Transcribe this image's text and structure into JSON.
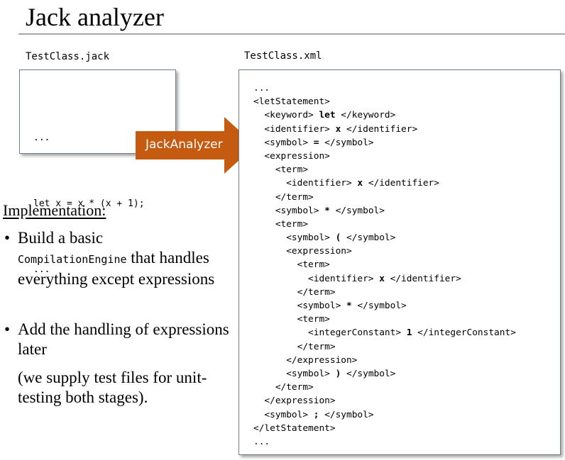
{
  "slide": {
    "title": "Jack analyzer"
  },
  "source": {
    "filename": "TestClass.jack",
    "lines": [
      "...",
      "let x = x * (x + 1);",
      "..."
    ]
  },
  "arrow": {
    "label": "JackAnalyzer",
    "color": "#c55a11"
  },
  "output": {
    "filename": "TestClass.xml",
    "lines": [
      {
        "pre": "...",
        "bold": "",
        "post": ""
      },
      {
        "pre": "<letStatement>",
        "bold": "",
        "post": ""
      },
      {
        "pre": "  <keyword> ",
        "bold": "let",
        "post": " </keyword>"
      },
      {
        "pre": "  <identifier> ",
        "bold": "x",
        "post": " </identifier>"
      },
      {
        "pre": "  <symbol> ",
        "bold": "=",
        "post": " </symbol>"
      },
      {
        "pre": "  <expression>",
        "bold": "",
        "post": ""
      },
      {
        "pre": "    <term>",
        "bold": "",
        "post": ""
      },
      {
        "pre": "      <identifier> ",
        "bold": "x",
        "post": " </identifier>"
      },
      {
        "pre": "    </term>",
        "bold": "",
        "post": ""
      },
      {
        "pre": "    <symbol> ",
        "bold": "*",
        "post": " </symbol>"
      },
      {
        "pre": "    <term>",
        "bold": "",
        "post": ""
      },
      {
        "pre": "      <symbol> ",
        "bold": "(",
        "post": " </symbol>"
      },
      {
        "pre": "      <expression>",
        "bold": "",
        "post": ""
      },
      {
        "pre": "        <term>",
        "bold": "",
        "post": ""
      },
      {
        "pre": "          <identifier> ",
        "bold": "x",
        "post": " </identifier>"
      },
      {
        "pre": "        </term>",
        "bold": "",
        "post": ""
      },
      {
        "pre": "        <symbol> ",
        "bold": "*",
        "post": " </symbol>"
      },
      {
        "pre": "        <term>",
        "bold": "",
        "post": ""
      },
      {
        "pre": "          <integerConstant> ",
        "bold": "1",
        "post": " </integerConstant>"
      },
      {
        "pre": "        </term>",
        "bold": "",
        "post": ""
      },
      {
        "pre": "      </expression>",
        "bold": "",
        "post": ""
      },
      {
        "pre": "      <symbol> ",
        "bold": ")",
        "post": " </symbol>"
      },
      {
        "pre": "    </term>",
        "bold": "",
        "post": ""
      },
      {
        "pre": "  </expression>",
        "bold": "",
        "post": ""
      },
      {
        "pre": "  <symbol> ",
        "bold": ";",
        "post": " </symbol>"
      },
      {
        "pre": "</letStatement>",
        "bold": "",
        "post": ""
      },
      {
        "pre": "...",
        "bold": "",
        "post": ""
      }
    ]
  },
  "implementation": {
    "heading": "Implementation:",
    "bullets": [
      {
        "marker": "•",
        "before": "Build a basic",
        "code": "CompilationEngine",
        "after": " that handles everything except expressions"
      },
      {
        "marker": "•",
        "text": "Add the handling of expressions later"
      }
    ],
    "note": "(we supply test files for unit-testing both stages)."
  }
}
